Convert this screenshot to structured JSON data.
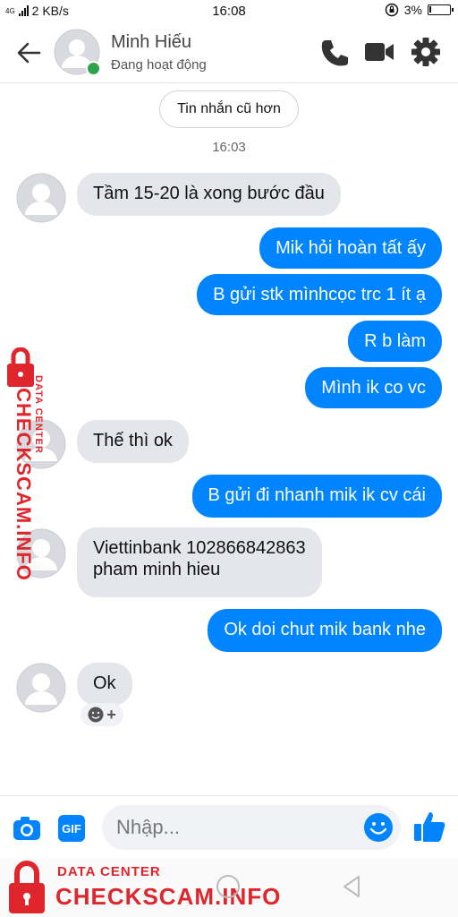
{
  "status_bar": {
    "network": "4G",
    "speed": "2 KB/s",
    "time": "16:08",
    "battery": "3%"
  },
  "header": {
    "contact_name": "Minh Hiếu",
    "status": "Đang hoạt động"
  },
  "older_messages_label": "Tin nhắn cũ hơn",
  "timestamp": "16:03",
  "messages": [
    {
      "from": "them",
      "text": "Tầm 15-20 là xong bước đầu"
    },
    {
      "from": "me",
      "text": "Mik hỏi hoàn tất ấy"
    },
    {
      "from": "me",
      "text": "B gửi stk  mìnhcọc trc 1 ít ạ"
    },
    {
      "from": "me",
      "text": "R b làm"
    },
    {
      "from": "me",
      "text": "Mình ik co vc"
    },
    {
      "from": "them",
      "text": "Thế thì ok"
    },
    {
      "from": "me",
      "text": "B gửi đi nhanh mik ik cv cái"
    },
    {
      "from": "them",
      "lines": [
        "Viettinbank 102866842863",
        "pham minh hieu"
      ]
    },
    {
      "from": "me",
      "text": "Ok doi chut mik bank nhe"
    },
    {
      "from": "them",
      "text": "Ok"
    }
  ],
  "composer": {
    "placeholder": "Nhập..."
  },
  "watermark": {
    "line1": "DATA CENTER",
    "line2": "CHECKSCAM.INFO"
  },
  "colors": {
    "outgoing_bubble": "#0084ff",
    "incoming_bubble": "#e4e6eb",
    "accent": "#0084ff",
    "online": "#31a24c",
    "watermark": "#e0262d"
  }
}
